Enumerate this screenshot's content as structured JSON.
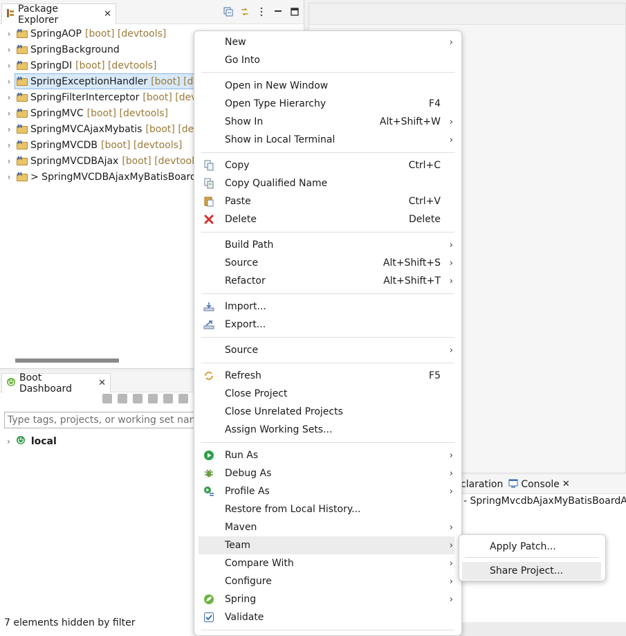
{
  "package_explorer": {
    "tab_label": "Package Explorer",
    "projects": [
      {
        "name": "SpringAOP",
        "decoration": "[boot] [devtools]"
      },
      {
        "name": "SpringBackground",
        "decoration": ""
      },
      {
        "name": "SpringDI",
        "decoration": "[boot] [devtools]"
      },
      {
        "name": "SpringExceptionHandler",
        "decoration": "[boot] [de",
        "selected": true
      },
      {
        "name": "SpringFilterInterceptor",
        "decoration": "[boot] [dev"
      },
      {
        "name": "SpringMVC",
        "decoration": "[boot] [devtools]"
      },
      {
        "name": "SpringMVCAjaxMybatis",
        "decoration": "[boot] [de"
      },
      {
        "name": "SpringMVCDB",
        "decoration": "[boot] [devtools]"
      },
      {
        "name": "SpringMVCDBAjax",
        "decoration": "[boot] [devtool"
      },
      {
        "name": "> SpringMVCDBAjaxMyBatisBoard",
        "decoration": ""
      }
    ]
  },
  "boot_dashboard": {
    "tab_label": "Boot Dashboard",
    "filter_placeholder": "Type tags, projects, or working set name",
    "local_label": "local"
  },
  "status": {
    "filter_message": "7 elements hidden by filter"
  },
  "console": {
    "partial_tab_label": "claration",
    "tab_label": "Console",
    "title": "- SpringMvcdbAjaxMyBatisBoardA"
  },
  "context_menu": {
    "items": [
      {
        "label": "New",
        "submenu": true
      },
      {
        "label": "Go Into"
      },
      {
        "label": "Open in New Window"
      },
      {
        "label": "Open Type Hierarchy",
        "accel": "F4"
      },
      {
        "label": "Show In",
        "accel": "Alt+Shift+W",
        "submenu": true
      },
      {
        "label": "Show in Local Terminal",
        "submenu": true
      },
      {
        "label": "Copy",
        "accel": "Ctrl+C",
        "icon": "copy-icon"
      },
      {
        "label": "Copy Qualified Name",
        "icon": "copy-qualified-icon"
      },
      {
        "label": "Paste",
        "accel": "Ctrl+V",
        "icon": "paste-icon"
      },
      {
        "label": "Delete",
        "accel": "Delete",
        "icon": "delete-icon"
      },
      {
        "label": "Build Path",
        "submenu": true
      },
      {
        "label": "Source",
        "accel": "Alt+Shift+S",
        "submenu": true
      },
      {
        "label": "Refactor",
        "accel": "Alt+Shift+T",
        "submenu": true
      },
      {
        "label": "Import...",
        "icon": "import-icon"
      },
      {
        "label": "Export...",
        "icon": "export-icon"
      },
      {
        "label": "Source",
        "submenu": true
      },
      {
        "label": "Refresh",
        "accel": "F5",
        "icon": "refresh-icon"
      },
      {
        "label": "Close Project"
      },
      {
        "label": "Close Unrelated Projects"
      },
      {
        "label": "Assign Working Sets..."
      },
      {
        "label": "Run As",
        "submenu": true,
        "icon": "run-icon"
      },
      {
        "label": "Debug As",
        "submenu": true,
        "icon": "debug-icon"
      },
      {
        "label": "Profile As",
        "submenu": true,
        "icon": "profile-icon"
      },
      {
        "label": "Restore from Local History..."
      },
      {
        "label": "Maven",
        "submenu": true
      },
      {
        "label": "Team",
        "submenu": true,
        "highlighted": true
      },
      {
        "label": "Compare With",
        "submenu": true
      },
      {
        "label": "Configure",
        "submenu": true
      },
      {
        "label": "Spring",
        "submenu": true,
        "icon": "spring-icon"
      },
      {
        "label": "Validate",
        "icon": "validate-checkbox-icon"
      }
    ]
  },
  "team_submenu": {
    "items": [
      {
        "label": "Apply Patch..."
      },
      {
        "label": "Share Project...",
        "highlighted": true
      }
    ]
  },
  "colors": {
    "decoration": "#9c7a3a",
    "selection": "#d8e9f9",
    "delete_red": "#d9302c",
    "run_green": "#2e9e4a",
    "spring_green": "#6db33f"
  }
}
